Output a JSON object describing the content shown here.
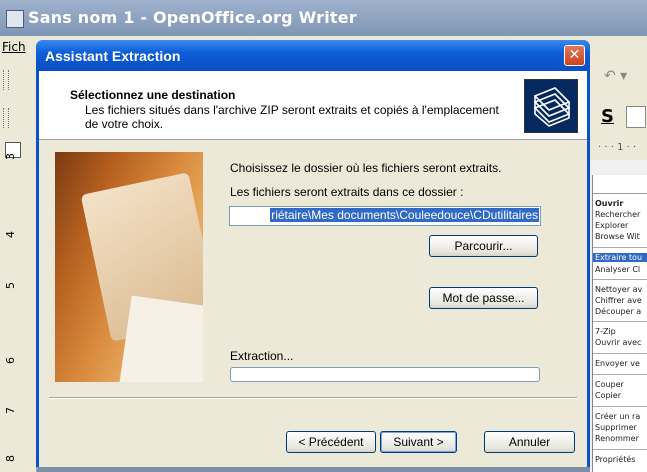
{
  "background_window": {
    "title": "Sans nom 1 - OpenOffice.org Writer",
    "menu_first": "Fich",
    "ruler_numbers": [
      "3",
      "4",
      "5",
      "6",
      "7",
      "8"
    ],
    "hruler_text": "· · · 1 · ·",
    "toolbar_s": "S"
  },
  "context_menu": {
    "items": [
      {
        "label": "Ouvrir",
        "bold": true
      },
      {
        "label": "Rechercher"
      },
      {
        "label": "Explorer"
      },
      {
        "label": "Browse Wit"
      },
      {
        "label": "Extraire tou",
        "selected": true
      },
      {
        "label": "Analyser Cl"
      },
      {
        "label": "Nettoyer av"
      },
      {
        "label": "Chiffrer ave"
      },
      {
        "label": "Découper a"
      },
      {
        "label": "7-Zip"
      },
      {
        "label": "Ouvrir avec"
      },
      {
        "label": "Envoyer ve"
      },
      {
        "label": "Couper"
      },
      {
        "label": "Copier"
      },
      {
        "label": "Créer un ra"
      },
      {
        "label": "Supprimer"
      },
      {
        "label": "Renommer"
      },
      {
        "label": "Propriétés"
      }
    ]
  },
  "dialog": {
    "title": "Assistant Extraction",
    "close_glyph": "✕",
    "header_title": "Sélectionnez une destination",
    "header_subtitle": "Les fichiers situés dans l'archive ZIP seront extraits et copiés à l'emplacement de votre choix.",
    "choose_label": "Choisissez le dossier où les fichiers seront extraits.",
    "dest_label": "Les fichiers seront extraits dans ce dossier :",
    "path_value": "riétaire\\Mes documents\\Couleedouce\\CDutilitaires",
    "browse_label": "Parcourir...",
    "password_label": "Mot de passe...",
    "extraction_label": "Extraction...",
    "progress": 0,
    "back_label": "< Précédent",
    "next_label": "Suivant >",
    "cancel_label": "Annuler"
  }
}
